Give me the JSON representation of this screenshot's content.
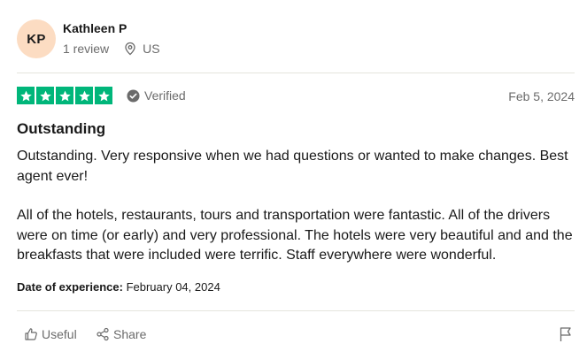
{
  "reviewer": {
    "initials": "KP",
    "name": "Kathleen P",
    "review_count": "1 review",
    "country": "US",
    "avatar_color": "#fcdcc2"
  },
  "rating": {
    "stars": 5,
    "max_stars": 5,
    "star_color": "#00b67a",
    "verified_label": "Verified",
    "date": "Feb 5, 2024"
  },
  "review": {
    "title": "Outstanding",
    "paragraphs": [
      "Outstanding. Very responsive when we had questions or wanted to make changes. Best agent ever!",
      "All of the hotels, restaurants, tours and transportation were fantastic. All of the drivers were on time (or early) and very professional. The hotels were very beautiful and and the breakfasts that were included were terrific. Staff everywhere were wonderful."
    ],
    "experience_label": "Date of experience:",
    "experience_date": "February 04, 2024"
  },
  "actions": {
    "useful_label": "Useful",
    "share_label": "Share",
    "icons": [
      "thumbs-up-icon",
      "share-icon",
      "flag-icon"
    ]
  }
}
